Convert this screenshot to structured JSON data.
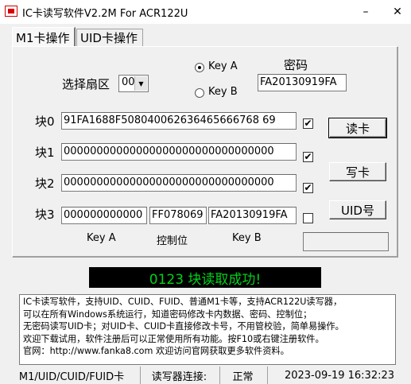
{
  "window": {
    "title": "IC卡读写软件V2.2M For ACR122U",
    "minimize": "–",
    "close": "✕"
  },
  "tabs": [
    {
      "label": "M1卡操作"
    },
    {
      "label": "UID卡操作"
    }
  ],
  "sector": {
    "label": "选择扇区",
    "value": "00"
  },
  "key_type": {
    "key_a": "Key A",
    "key_b": "Key B",
    "selected": "Key A"
  },
  "password": {
    "label": "密码",
    "value": "FA20130919FA"
  },
  "blocks": [
    {
      "label": "块0",
      "value": "91FA1688F508040062636465666768 69",
      "checked": true
    },
    {
      "label": "块1",
      "value": "00000000000000000000000000000000",
      "checked": true
    },
    {
      "label": "块2",
      "value": "00000000000000000000000000000000",
      "checked": true
    }
  ],
  "block3": {
    "label": "块3",
    "key_a": "000000000000",
    "access": "FF078069",
    "key_b": "FA20130919FA",
    "checked": false
  },
  "block3_labels": {
    "key_a": "Key A",
    "access": "控制位",
    "key_b": "Key B"
  },
  "buttons": {
    "read": "读卡",
    "write": "写卡",
    "uid": "UID号"
  },
  "uid_value": "",
  "status_message": "0123 块读取成功!",
  "info_lines": [
    "IC卡读写软件，支持UID、CUID、FUID、普通M1卡等，支持ACR122U读写器，",
    "可以在所有Windows系统运行，知道密码修改卡内数据、密码、控制位；",
    "无密码读写UID卡；对UID卡、CUID卡直接修改卡号，不用管校验，简单易操作。",
    "欢迎下载试用，软件注册后可以正常使用所有功能。按F10或右键注册软件。",
    "官网：http://www.fanka8.com 欢迎访问官网获取更多软件资料。"
  ],
  "statusbar": {
    "card_types": "M1/UID/CUID/FUID卡",
    "reader_label": "读写器连接:",
    "reader_status": "正常",
    "datetime": "2023-09-19 16:32:23"
  }
}
